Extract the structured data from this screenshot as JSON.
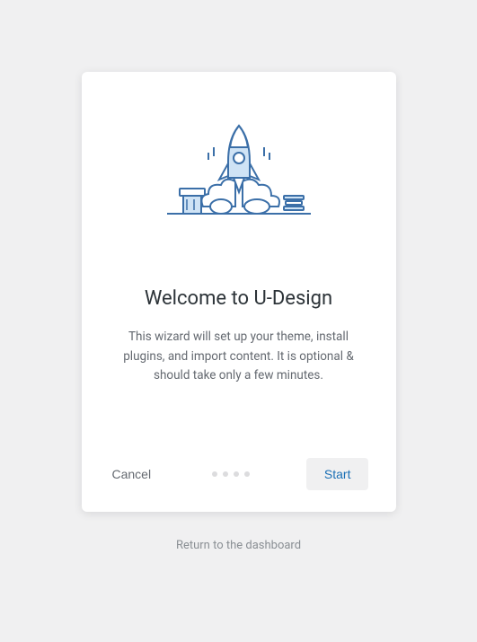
{
  "wizard": {
    "title": "Welcome to U-Design",
    "description": "This wizard will set up your theme, install plugins, and import content. It is optional & should take only a few minutes.",
    "cancel_label": "Cancel",
    "start_label": "Start",
    "step_count": 4,
    "current_step": 0
  },
  "return_link_label": "Return to the dashboard",
  "colors": {
    "illustration_stroke": "#3b6fa8",
    "illustration_fill": "#cfe3f5",
    "primary_button_text": "#1a6fb5",
    "muted_text": "#646970"
  }
}
